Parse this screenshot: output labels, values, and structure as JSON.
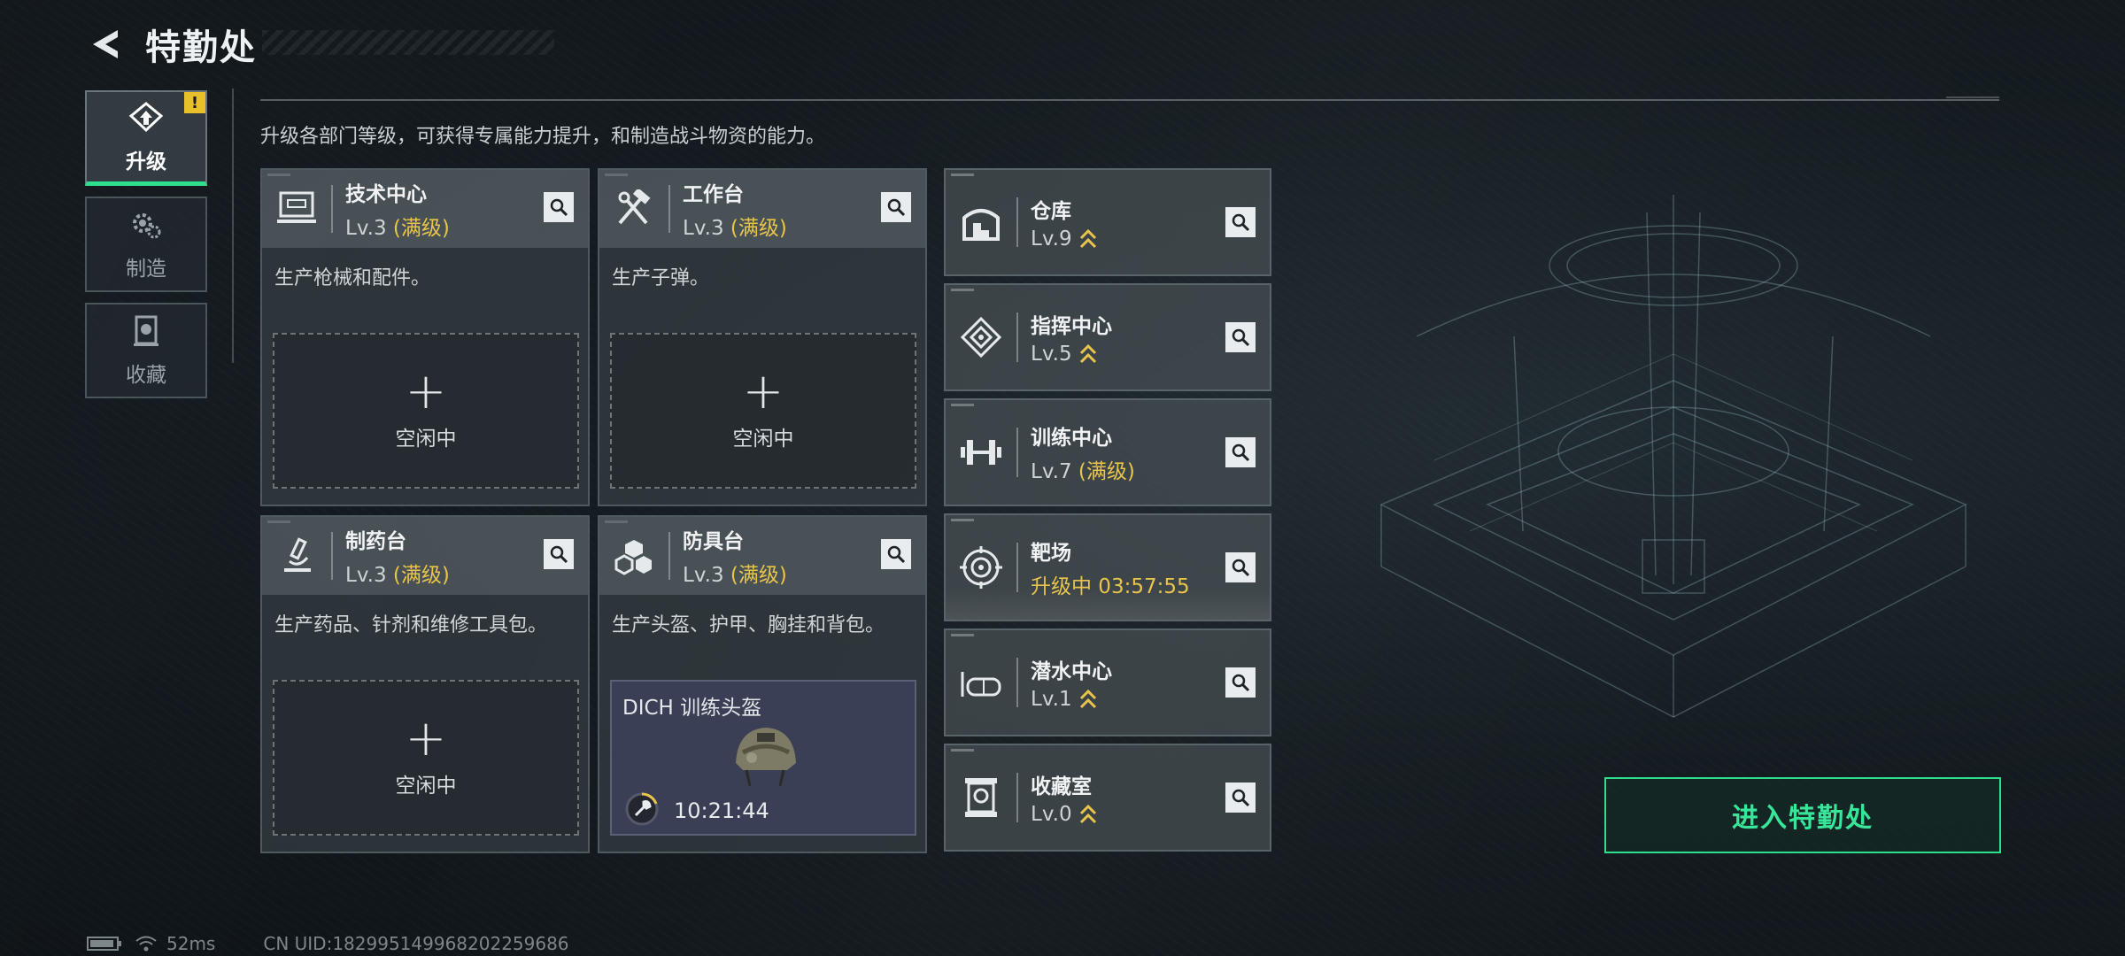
{
  "header": {
    "title": "特勤处"
  },
  "side_tabs": [
    {
      "label": "升级",
      "active": true,
      "alert": "!"
    },
    {
      "label": "制造",
      "active": false
    },
    {
      "label": "收藏",
      "active": false
    }
  ],
  "description": "升级各部门等级，可获得专属能力提升，和制造战斗物资的能力。",
  "big_cards": [
    {
      "title": "技术中心",
      "level": "Lv.3",
      "max": "(满级)",
      "desc": "生产枪械和配件。",
      "slot": {
        "label": "空闲中"
      }
    },
    {
      "title": "工作台",
      "level": "Lv.3",
      "max": "(满级)",
      "desc": "生产子弹。",
      "slot": {
        "label": "空闲中"
      }
    },
    {
      "title": "制药台",
      "level": "Lv.3",
      "max": "(满级)",
      "desc": "生产药品、针剂和维修工具包。",
      "slot": {
        "label": "空闲中"
      }
    },
    {
      "title": "防具台",
      "level": "Lv.3",
      "max": "(满级)",
      "desc": "生产头盔、护甲、胸挂和背包。",
      "crafting": {
        "item": "DICH 训练头盔",
        "time": "10:21:44"
      }
    }
  ],
  "list_cards": [
    {
      "title": "仓库",
      "level": "Lv.9",
      "status": "upgradable"
    },
    {
      "title": "指挥中心",
      "level": "Lv.5",
      "status": "upgradable"
    },
    {
      "title": "训练中心",
      "level": "Lv.7",
      "max": "(满级)"
    },
    {
      "title": "靶场",
      "upgrading": "升级中 03:57:55"
    },
    {
      "title": "潜水中心",
      "level": "Lv.1",
      "status": "upgradable"
    },
    {
      "title": "收藏室",
      "level": "Lv.0",
      "status": "upgradable"
    }
  ],
  "enter_button": "进入特勤处",
  "status_bar": {
    "ping": "52ms",
    "uid": "CN UID:18299514996820225968​6"
  },
  "colors": {
    "accent_green": "#2ee08e",
    "max_yellow": "#e8c54a",
    "alert_yellow": "#e8c02a"
  },
  "icons": {
    "back": "chevron-left-icon",
    "search": "magnifier-icon",
    "level_up": "double-chevron-up-icon"
  }
}
